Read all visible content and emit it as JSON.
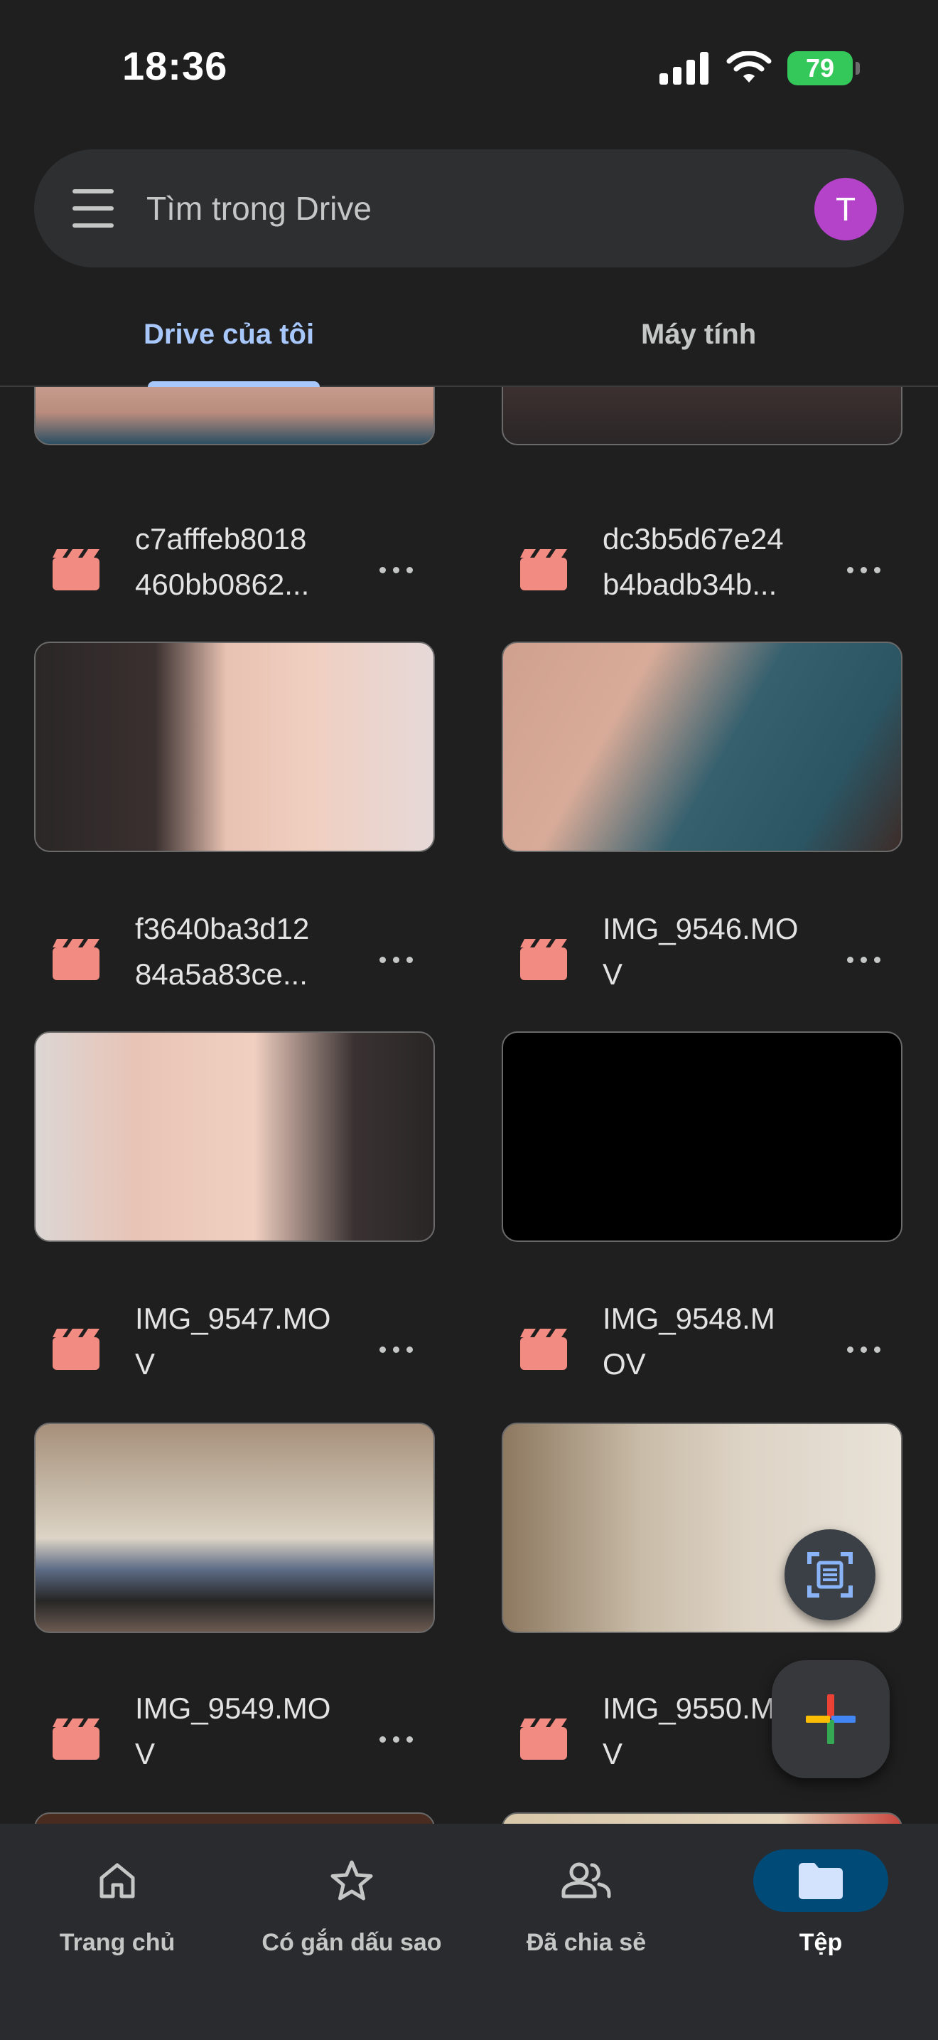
{
  "status_bar": {
    "time": "18:36",
    "battery": "79"
  },
  "search": {
    "placeholder": "Tìm trong Drive",
    "avatar_letter": "T"
  },
  "tabs": [
    {
      "label": "Drive của tôi",
      "active": true
    },
    {
      "label": "Máy tính",
      "active": false
    }
  ],
  "files": [
    {
      "name": "c7afffeb8018\n460bb0862...",
      "type": "video"
    },
    {
      "name": "dc3b5d67e24\nb4badb34b...",
      "type": "video"
    },
    {
      "name": "f3640ba3d12\n84a5a83ce...",
      "type": "video"
    },
    {
      "name": "IMG_9546.MO\nV",
      "type": "video"
    },
    {
      "name": "IMG_9547.MO\nV",
      "type": "video"
    },
    {
      "name": "IMG_9548.M\nOV",
      "type": "video"
    },
    {
      "name": "IMG_9549.MO\nV",
      "type": "video"
    },
    {
      "name": "IMG_9550.M\nV",
      "type": "video"
    }
  ],
  "bottom_nav": [
    {
      "label": "Trang chủ",
      "icon": "home-icon",
      "active": false
    },
    {
      "label": "Có gắn dấu sao",
      "icon": "star-icon",
      "active": false
    },
    {
      "label": "Đã chia sẻ",
      "icon": "people-icon",
      "active": false
    },
    {
      "label": "Tệp",
      "icon": "folder-icon",
      "active": true
    }
  ],
  "colors": {
    "background": "#1f1f1f",
    "accent": "#a8c7fa",
    "video_icon": "#f28b82",
    "nav_active": "#004a77",
    "avatar": "#b443c9",
    "battery": "#34c759"
  }
}
